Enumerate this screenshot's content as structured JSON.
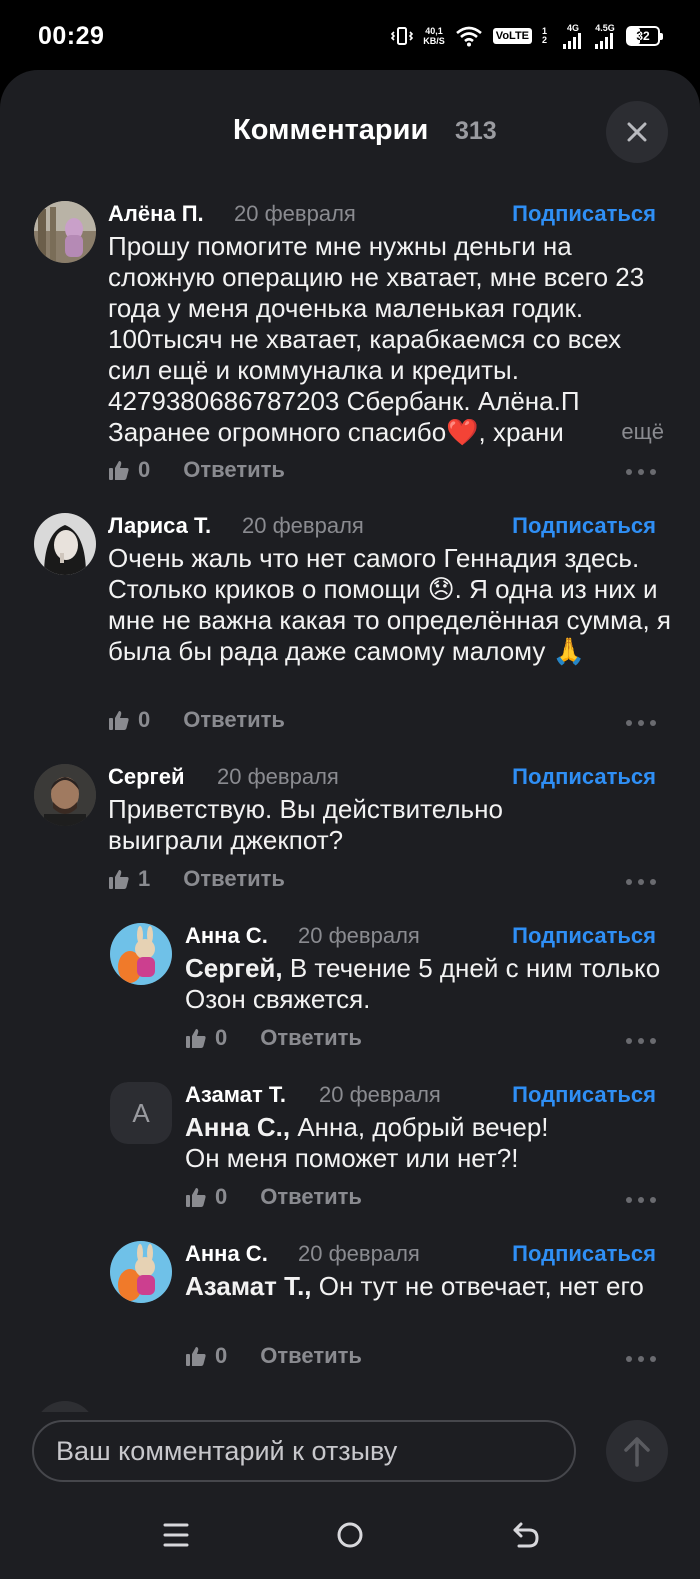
{
  "status_bar": {
    "time": "00:29",
    "net_speed_value": "40,1",
    "net_speed_unit": "KB/S",
    "volte": "VoLTE",
    "volte_sims": "1 2",
    "signal1_label": "4G",
    "signal2_label": "4.5G",
    "battery": "32",
    "icons": [
      "vibrate-icon",
      "wifi-icon",
      "signal-icon",
      "signal-icon",
      "battery-icon"
    ]
  },
  "header": {
    "title": "Комментарии",
    "count": "313",
    "close_icon": "close-icon"
  },
  "comments": [
    {
      "name": "Алёна П.",
      "date": "20 февраля",
      "subscribe": "Подписаться",
      "text": "Прошу помогите мне нужны деньги на сложную операцию не хватает,  мне всего 23 года у меня доченька маленькая годик. 100тысяч не хватает, карабкаемся со всех сил ещё и коммуналка и кредиты. 4279380686787203 Сбербанк. Алёна.П Заранее огромного спасибо❤️, храни",
      "more": "ещё",
      "likes": "0",
      "reply": "Ответить"
    },
    {
      "name": "Лариса Т.",
      "date": "20 февраля",
      "subscribe": "Подписаться",
      "text": "Очень жаль что нет самого Геннадия здесь. Столько криков о помощи 😞. Я одна из них и мне не важна какая то определённая сумма, я была бы рада даже самому малому 🙏",
      "likes": "0",
      "reply": "Ответить"
    },
    {
      "name": "Сергей",
      "date": "20 февраля",
      "subscribe": "Подписаться",
      "text": "Приветствую. Вы действительно выиграли джекпот?",
      "likes": "1",
      "reply": "Ответить"
    },
    {
      "name": "Анна С.",
      "date": "20 февраля",
      "subscribe": "Подписаться",
      "mention": "Сергей,",
      "text": " В течение 5 дней с ним только Озон свяжется.",
      "likes": "0",
      "reply": "Ответить"
    },
    {
      "name": "Азамат Т.",
      "date": "20 февраля",
      "subscribe": "Подписаться",
      "avatar_letter": "А",
      "mention": "Анна С.,",
      "text": " Анна, добрый вечер! Он меня поможет или нет?!",
      "likes": "0",
      "reply": "Ответить"
    },
    {
      "name": "Анна С.",
      "date": "20 февраля",
      "subscribe": "Подписаться",
      "mention": "Азамат Т.,",
      "text": " Он тут не отвечает, нет его",
      "likes": "0",
      "reply": "Ответить"
    }
  ],
  "input": {
    "placeholder": "Ваш комментарий к отзыву",
    "send_icon": "arrow-up-icon"
  },
  "nav": {
    "icons": [
      "menu-icon",
      "home-icon",
      "back-icon"
    ]
  },
  "colors": {
    "background": "#1d1e22",
    "accent": "#2f8ff5",
    "muted": "#8a8b90"
  }
}
